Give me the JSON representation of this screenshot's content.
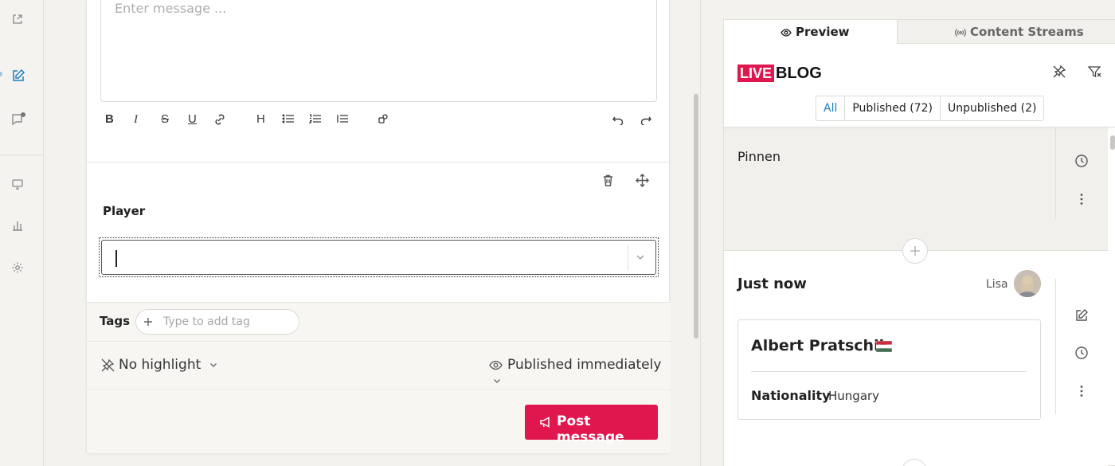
{
  "editor": {
    "message_placeholder": "Enter message ...",
    "player_label": "Player",
    "tags_label": "Tags",
    "tags_placeholder": "Type to add tag",
    "highlight_option": "No highlight",
    "publish_option": "Published immediately",
    "post_button": "Post message"
  },
  "preview": {
    "tabs": [
      {
        "label": "Preview",
        "active": true
      },
      {
        "label": "Content Streams",
        "active": false
      }
    ],
    "logo": {
      "live": "LIVE",
      "blog": "BLOG"
    },
    "filters": [
      "All",
      "Published (72)",
      "Unpublished (2)"
    ],
    "pinned_text": "Pinnen",
    "post": {
      "time": "Just now",
      "author": "Lisa",
      "player_name": "Albert Pratschik",
      "flag": "Hungary flag",
      "nationality_label": "Nationality",
      "nationality_value": "Hungary"
    }
  },
  "colors": {
    "accent": "#e0174f",
    "link": "#1a7fc1"
  }
}
